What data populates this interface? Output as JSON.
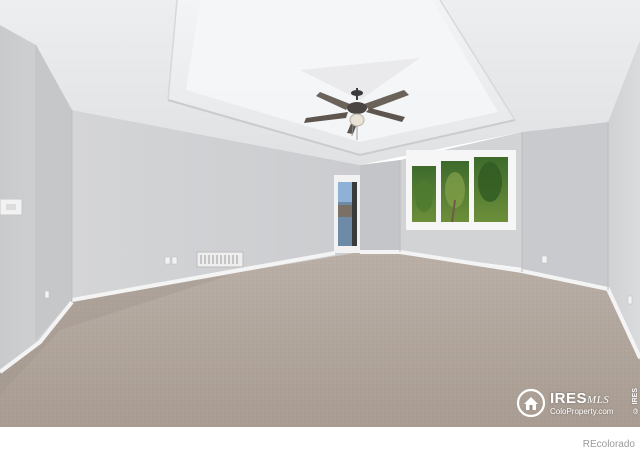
{
  "photo": {
    "scene": "empty-room"
  },
  "watermark": {
    "brand": "IRES",
    "brand_suffix": "MLS",
    "subtitle": "ColoProperty.com",
    "side_text": "© IRES",
    "logo_icon": "house-in-circle-icon"
  },
  "footer": {
    "credit": "REcolorado"
  },
  "colors": {
    "wall": "#cfd0d2",
    "ceiling": "#e9eaec",
    "carpet": "#b3a89f",
    "trim": "#f4f4f4"
  }
}
